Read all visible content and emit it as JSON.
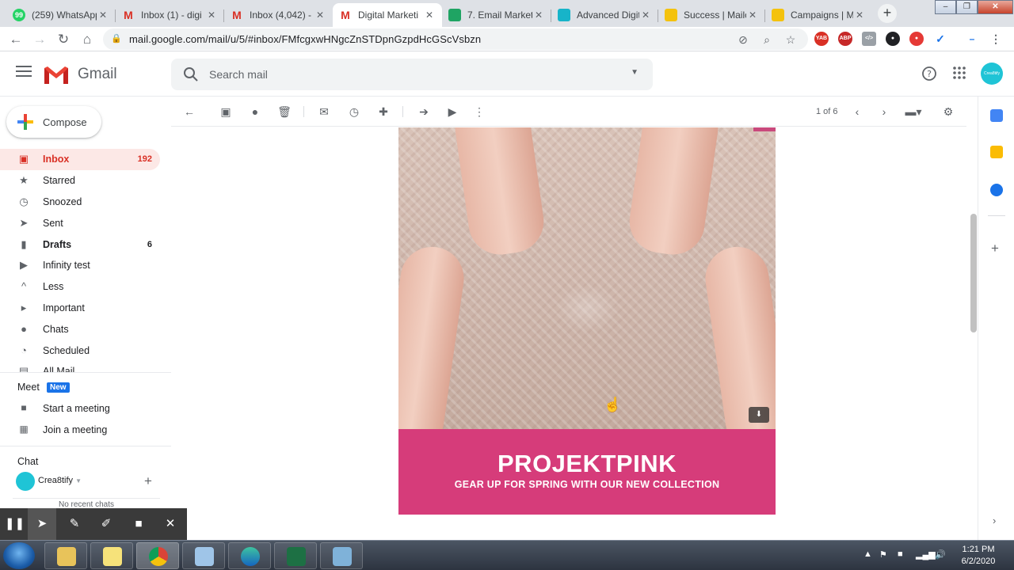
{
  "browser": {
    "tabs": [
      {
        "title": "(259) WhatsApp",
        "favicon": "whatsapp-icon",
        "color": "#25d366",
        "badge": "99"
      },
      {
        "title": "Inbox (1) - digi",
        "favicon": "gmail-icon",
        "color": "#d93025"
      },
      {
        "title": "Inbox (4,042) - ",
        "favicon": "gmail-icon",
        "color": "#d93025"
      },
      {
        "title": "Digital Marketi",
        "favicon": "gmail-icon",
        "color": "#d93025",
        "active": true
      },
      {
        "title": "7. Email Market",
        "favicon": "drive-icon",
        "color": "#1fa463"
      },
      {
        "title": "Advanced Digit",
        "favicon": "map-pin-icon",
        "color": "#17b4c9"
      },
      {
        "title": "Success | Mailc",
        "favicon": "mailchimp-icon",
        "color": "#f4c20d"
      },
      {
        "title": "Campaigns | M",
        "favicon": "mailchimp-icon",
        "color": "#f4c20d"
      }
    ],
    "url": "mail.google.com/mail/u/5/#inbox/FMfcgxwHNgcZnSTDpnGzpdHcGScVsbzn",
    "ext_yab": "YAB",
    "ext_abp": "ABP",
    "ext_abp_count": "1"
  },
  "gmail": {
    "logo_text": "Gmail",
    "search_placeholder": "Search mail",
    "account_initials": "Crea8tify",
    "compose_label": "Compose",
    "nav": [
      {
        "label": "Inbox",
        "count": "192",
        "icon": "inbox-icon",
        "active": true
      },
      {
        "label": "Starred",
        "count": "",
        "icon": "star-icon"
      },
      {
        "label": "Snoozed",
        "count": "",
        "icon": "clock-icon"
      },
      {
        "label": "Sent",
        "count": "",
        "icon": "send-icon"
      },
      {
        "label": "Drafts",
        "count": "6",
        "icon": "draft-icon",
        "bold": true
      },
      {
        "label": "Infinity test",
        "count": "",
        "icon": "label-icon"
      },
      {
        "label": "Less",
        "count": "",
        "icon": "chevron-up-icon"
      },
      {
        "label": "Important",
        "count": "",
        "icon": "important-icon"
      },
      {
        "label": "Chats",
        "count": "",
        "icon": "chat-icon"
      },
      {
        "label": "Scheduled",
        "count": "",
        "icon": "scheduled-icon"
      },
      {
        "label": "All Mail",
        "count": "",
        "icon": "all-mail-icon"
      }
    ],
    "meet": {
      "title": "Meet",
      "badge": "New",
      "start": "Start a meeting",
      "join": "Join a meeting"
    },
    "chat": {
      "title": "Chat",
      "user": "Crea8tify",
      "empty": "No recent chats"
    },
    "pager": "1 of 6"
  },
  "email": {
    "brand": "PROJEKTPINK",
    "tagline": "GEAR UP FOR SPRING WITH OUR NEW COLLECTION",
    "banner_color": "#d63c7a"
  },
  "taskbar": {
    "time": "1:21 PM",
    "date": "6/2/2020"
  }
}
